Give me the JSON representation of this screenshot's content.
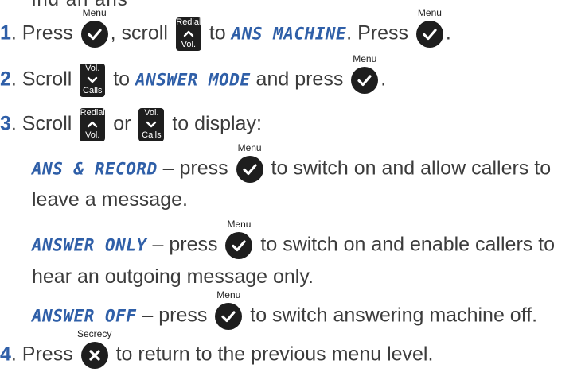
{
  "top_fragment": "ing an ans",
  "keys": {
    "menu": "Menu",
    "redial": "Redial",
    "vol": "Vol.",
    "calls": "Calls",
    "secrecy": "Secrecy"
  },
  "steps": [
    {
      "num": "1",
      "t1": ". Press ",
      "t2": ", scroll ",
      "t3": " to ",
      "lcd": "ANS MACHINE",
      "t4": ". Press ",
      "t5": "."
    },
    {
      "num": "2",
      "t1": ". Scroll ",
      "t2": " to ",
      "lcd": "ANSWER MODE",
      "t3": " and press ",
      "t4": "."
    },
    {
      "num": "3",
      "t1": ". Scroll ",
      "t2": " or ",
      "t3": " to display:"
    },
    {
      "num": "4",
      "t1": ". Press ",
      "t2": " to return to the previous menu level."
    }
  ],
  "options": [
    {
      "lcd": "ANS & RECORD",
      "t1": " – press ",
      "t2": " to switch on and allow callers to",
      "cont": "leave a message."
    },
    {
      "lcd": "ANSWER ONLY",
      "t1": " – press ",
      "t2": " to switch on and enable callers to",
      "cont": "hear an outgoing message only."
    },
    {
      "lcd": "ANSWER OFF",
      "t1": " – press ",
      "t2": " to switch answering machine off."
    }
  ]
}
